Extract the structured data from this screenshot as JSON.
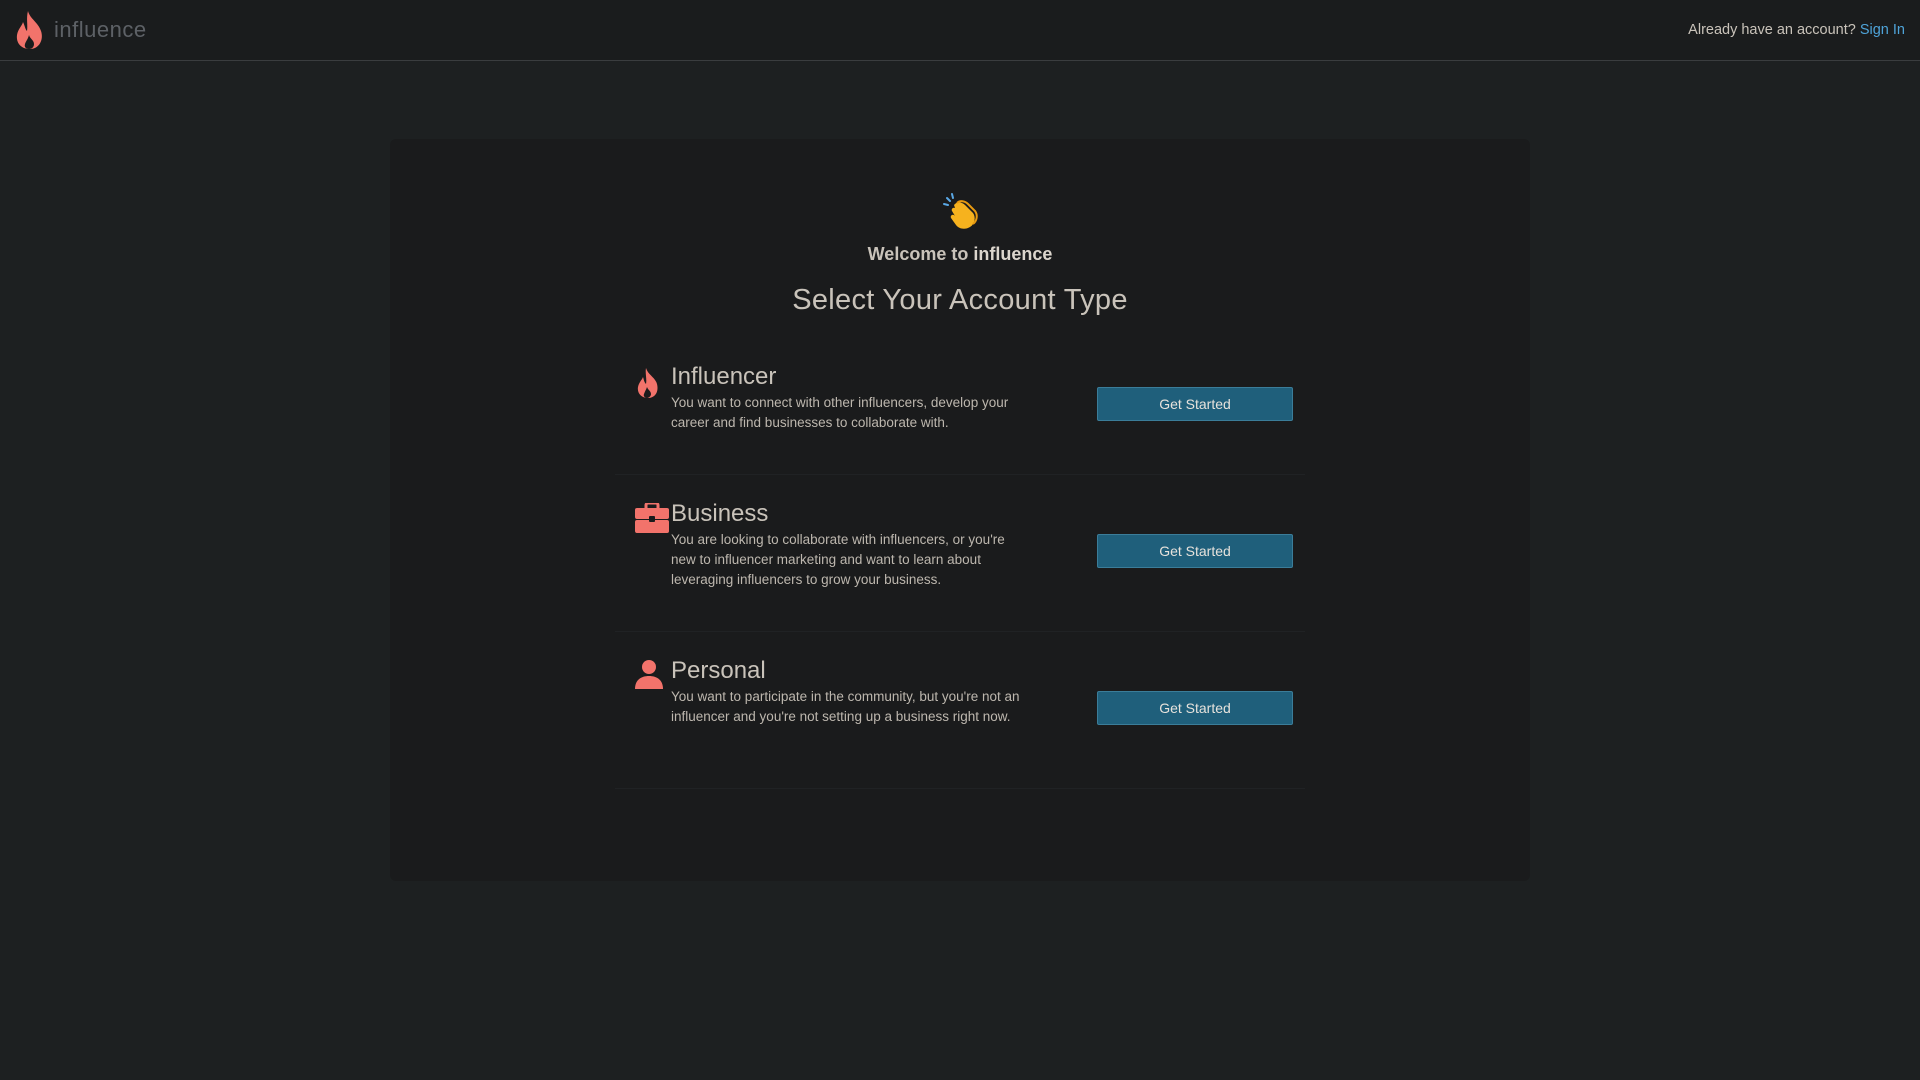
{
  "header": {
    "brand_name": "influence",
    "auth_prompt": "Already have an account?",
    "sign_in_label": "Sign In"
  },
  "hero": {
    "welcome_prefix": "Welcome to",
    "welcome_brand": "influence",
    "title": "Select Your Account Type"
  },
  "accounts": [
    {
      "icon": "flame-icon",
      "title": "Influencer",
      "description": "You want to connect with other influencers, develop your career and find businesses to collaborate with.",
      "button_label": "Get Started"
    },
    {
      "icon": "briefcase-icon",
      "title": "Business",
      "description": "You are looking to collaborate with influencers, or you're new to influencer marketing and want to learn about leveraging influencers to grow your business.",
      "button_label": "Get Started"
    },
    {
      "icon": "person-icon",
      "title": "Personal",
      "description": "You want to participate in the community, but you're not an influencer and you're not setting up a business right now.",
      "button_label": "Get Started"
    }
  ],
  "colors": {
    "accent_icon": "#f2736b",
    "button_bg": "#1f5f7b",
    "link": "#4ea3d8",
    "background": "#1d2021"
  }
}
